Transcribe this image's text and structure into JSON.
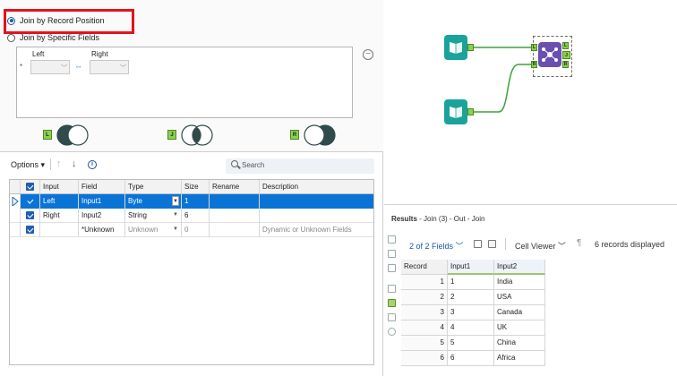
{
  "config": {
    "join_record_position": "Join by Record Position",
    "join_specific_fields": "Join by Specific Fields",
    "left_label": "Left",
    "right_label": "Right",
    "row_marker": "*",
    "venn_left_tag": "L",
    "venn_join_tag": "J",
    "venn_right_tag": "R"
  },
  "toolbar": {
    "options_label": "Options",
    "options_caret": "▾",
    "search_placeholder": "Search"
  },
  "grid": {
    "headers": [
      "Input",
      "Field",
      "Type",
      "Size",
      "Rename",
      "Description"
    ],
    "rows": [
      {
        "input": "Left",
        "field": "Input1",
        "type": "Byte",
        "size": "1",
        "rename": "",
        "description": ""
      },
      {
        "input": "Right",
        "field": "Input2",
        "type": "String",
        "size": "6",
        "rename": "",
        "description": ""
      },
      {
        "input": "",
        "field": "*Unknown",
        "type": "Unknown",
        "size": "0",
        "rename": "",
        "description": "Dynamic or Unknown Fields"
      }
    ]
  },
  "results": {
    "title_bold": "Results",
    "title_rest": " - Join (3) - Out - Join",
    "fields_label": "2 of 2 Fields",
    "cell_viewer_label": "Cell Viewer",
    "records_label": "6 records displayed",
    "headers": [
      "Record",
      "Input1",
      "Input2"
    ],
    "rows": [
      {
        "record": "1",
        "input1": "1",
        "input2": "India"
      },
      {
        "record": "2",
        "input1": "2",
        "input2": "USA"
      },
      {
        "record": "3",
        "input1": "3",
        "input2": "Canada"
      },
      {
        "record": "4",
        "input1": "4",
        "input2": "UK"
      },
      {
        "record": "5",
        "input1": "5",
        "input2": "China"
      },
      {
        "record": "6",
        "input1": "6",
        "input2": "Africa"
      }
    ]
  },
  "canvas": {
    "join_anchor_left": "L",
    "join_anchor_right": "R",
    "join_out_l": "L",
    "join_out_j": "J",
    "join_out_r": "R"
  },
  "colors": {
    "accent": "#0a74d6",
    "input_tool": "#1aa39a",
    "join_tool": "#6b4fb0",
    "highlight": "#e1141c",
    "connector": "#3aa33a"
  }
}
